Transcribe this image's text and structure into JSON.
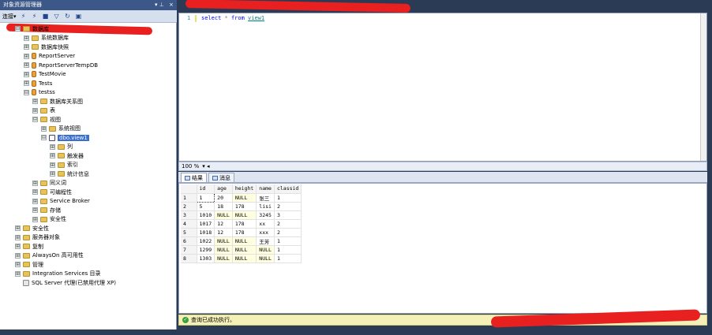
{
  "object_explorer": {
    "title": "对象资源管理器",
    "controls": {
      "pin": "▾ ⊥",
      "close": "×"
    },
    "toolbar": {
      "connect": "连接▾"
    },
    "tree": [
      {
        "label": "数据库",
        "indent": 1,
        "icon": "folder",
        "exp": "⊟"
      },
      {
        "label": "系统数据库",
        "indent": 2,
        "icon": "folder",
        "exp": "⊞"
      },
      {
        "label": "数据库快照",
        "indent": 2,
        "icon": "folder",
        "exp": "⊞"
      },
      {
        "label": "ReportServer",
        "indent": 2,
        "icon": "db",
        "exp": "⊞"
      },
      {
        "label": "ReportServerTempDB",
        "indent": 2,
        "icon": "db",
        "exp": "⊞"
      },
      {
        "label": "TestMovie",
        "indent": 2,
        "icon": "db",
        "exp": "⊞"
      },
      {
        "label": "Tests",
        "indent": 2,
        "icon": "db",
        "exp": "⊞"
      },
      {
        "label": "testss",
        "indent": 2,
        "icon": "db",
        "exp": "⊟"
      },
      {
        "label": "数据库关系图",
        "indent": 3,
        "icon": "folder",
        "exp": "⊞"
      },
      {
        "label": "表",
        "indent": 3,
        "icon": "folder",
        "exp": "⊞"
      },
      {
        "label": "视图",
        "indent": 3,
        "icon": "folder",
        "exp": "⊟"
      },
      {
        "label": "系统视图",
        "indent": 4,
        "icon": "folder",
        "exp": "⊞"
      },
      {
        "label": "dbo.view1",
        "indent": 4,
        "icon": "view",
        "exp": "⊟",
        "selected": true
      },
      {
        "label": "列",
        "indent": 5,
        "icon": "folder",
        "exp": "⊞"
      },
      {
        "label": "触发器",
        "indent": 5,
        "icon": "folder",
        "exp": "⊞"
      },
      {
        "label": "索引",
        "indent": 5,
        "icon": "folder",
        "exp": "⊞"
      },
      {
        "label": "统计信息",
        "indent": 5,
        "icon": "folder",
        "exp": "⊞"
      },
      {
        "label": "同义词",
        "indent": 3,
        "icon": "folder",
        "exp": "⊞"
      },
      {
        "label": "可编程性",
        "indent": 3,
        "icon": "folder",
        "exp": "⊞"
      },
      {
        "label": "Service Broker",
        "indent": 3,
        "icon": "folder",
        "exp": "⊞"
      },
      {
        "label": "存储",
        "indent": 3,
        "icon": "folder",
        "exp": "⊞"
      },
      {
        "label": "安全性",
        "indent": 3,
        "icon": "folder",
        "exp": "⊞"
      },
      {
        "label": "安全性",
        "indent": 1,
        "icon": "folder",
        "exp": "⊞"
      },
      {
        "label": "服务器对象",
        "indent": 1,
        "icon": "folder",
        "exp": "⊞"
      },
      {
        "label": "复制",
        "indent": 1,
        "icon": "folder",
        "exp": "⊞"
      },
      {
        "label": "AlwaysOn 高可用性",
        "indent": 1,
        "icon": "folder",
        "exp": "⊞"
      },
      {
        "label": "管理",
        "indent": 1,
        "icon": "folder",
        "exp": "⊞"
      },
      {
        "label": "Integration Services 目录",
        "indent": 1,
        "icon": "folder",
        "exp": "⊞"
      },
      {
        "label": "SQL Server 代理(已禁用代理 XP)",
        "indent": 1,
        "icon": "agent",
        "exp": ""
      }
    ]
  },
  "editor": {
    "line_number": "1",
    "code": {
      "kw1": "select",
      "op": "*",
      "kw2": "from",
      "obj": "view1"
    }
  },
  "zoom": {
    "value": "100 %",
    "arrow": "▾ ◂"
  },
  "result_tabs": [
    {
      "label": "结果"
    },
    {
      "label": "消息"
    }
  ],
  "grid": {
    "columns": [
      "id",
      "age",
      "height",
      "name",
      "classid"
    ],
    "rows": [
      [
        "1",
        "20",
        "NULL",
        "张三",
        "1"
      ],
      [
        "5",
        "18",
        "178",
        "lisi",
        "2"
      ],
      [
        "1010",
        "NULL",
        "NULL",
        "3245",
        "3"
      ],
      [
        "1017",
        "12",
        "178",
        "xx",
        "2"
      ],
      [
        "1018",
        "12",
        "178",
        "xxx",
        "2"
      ],
      [
        "1022",
        "NULL",
        "NULL",
        "王芳",
        "1"
      ],
      [
        "1299",
        "NULL",
        "NULL",
        "NULL",
        "1"
      ],
      [
        "1303",
        "NULL",
        "NULL",
        "NULL",
        "1"
      ]
    ]
  },
  "status": {
    "text": "查询已成功执行。"
  }
}
